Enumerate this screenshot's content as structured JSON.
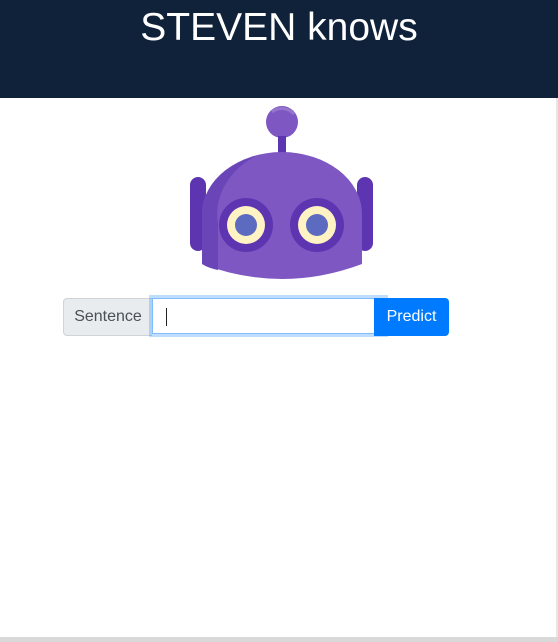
{
  "header": {
    "title": "STEVEN knows"
  },
  "form": {
    "addon_label": "Sentence",
    "input_value": "",
    "input_placeholder": "",
    "predict_label": "Predict"
  },
  "robot": {
    "icon": "robot-mascot-icon",
    "colors": {
      "head": "#7e57c2",
      "head_dark": "#5e35b1",
      "eye_ring": "#5e35b1",
      "eye_white": "#fff3c4",
      "pupil": "#5c6bc0"
    }
  },
  "colors": {
    "header_bg": "#0f223a",
    "accent": "#007bff"
  }
}
